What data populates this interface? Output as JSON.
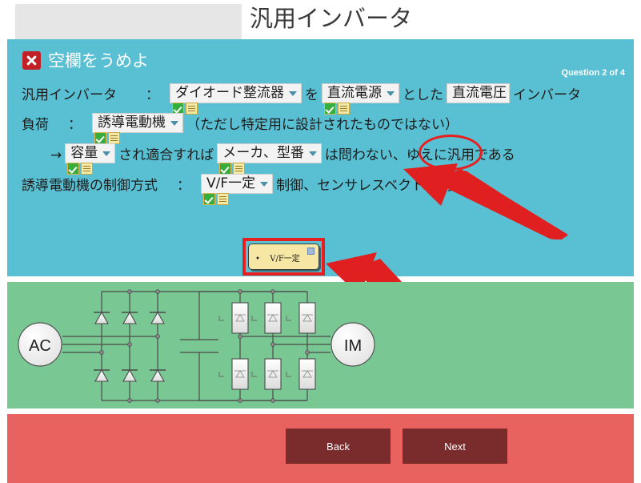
{
  "page": {
    "title": "汎用インバータ"
  },
  "question_panel": {
    "header_label": "空欄をうめよ",
    "header_icon": "x-mark-icon",
    "counter": "Question 2 of 4",
    "accent_color": "#59bfd2",
    "lines": [
      {
        "id": "line1",
        "segments": [
          {
            "type": "text",
            "value": "汎用インバータ"
          },
          {
            "type": "text",
            "value": "："
          },
          {
            "type": "blank",
            "value": "ダイオード整流器",
            "status": "correct"
          },
          {
            "type": "text",
            "value": "を"
          },
          {
            "type": "blank",
            "value": "直流電源",
            "status": "correct"
          },
          {
            "type": "text",
            "value": "とした"
          },
          {
            "type": "blank",
            "value": "直流電圧",
            "status": "incorrect"
          },
          {
            "type": "text",
            "value": "インバータ"
          }
        ]
      },
      {
        "id": "line2",
        "segments": [
          {
            "type": "text",
            "value": "負荷"
          },
          {
            "type": "text",
            "value": "："
          },
          {
            "type": "blank",
            "value": "誘導電動機",
            "status": "correct"
          },
          {
            "type": "text",
            "value": "（ただし特定用に設計されたものではない）"
          }
        ]
      },
      {
        "id": "line3",
        "segments": [
          {
            "type": "text",
            "value": "→"
          },
          {
            "type": "blank",
            "value": "容量",
            "status": "correct"
          },
          {
            "type": "text",
            "value": "され適合すれば"
          },
          {
            "type": "blank",
            "value": "メーカ、型番",
            "status": "correct"
          },
          {
            "type": "text",
            "value": "は問わない、ゆえに汎用である"
          }
        ]
      },
      {
        "id": "line4",
        "segments": [
          {
            "type": "text",
            "value": "誘導電動機の制御方式"
          },
          {
            "type": "text",
            "value": "："
          },
          {
            "type": "blank",
            "value": "V/F一定",
            "status": "correct"
          },
          {
            "type": "text",
            "value": "制御、センサレスベクトル制御"
          }
        ]
      }
    ],
    "tooltip": {
      "item": "V/F一定",
      "bullet": "•",
      "close_icon": "close-icon"
    },
    "annotations": {
      "ellipse_color": "#e81f1f",
      "arrow_color": "#e02020",
      "arrow_count": 2
    }
  },
  "circuit_panel": {
    "background_color": "#79c893",
    "source_label": "AC",
    "load_label": "IM",
    "description": "three-phase diode rectifier, DC link capacitor, IGBT inverter bridge"
  },
  "footer": {
    "background_color": "#e8635f",
    "back_label": "Back",
    "next_label": "Next"
  }
}
